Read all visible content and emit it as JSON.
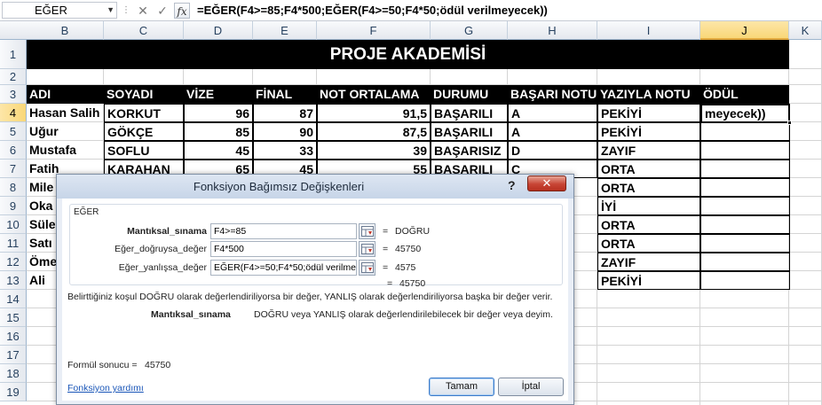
{
  "formula_bar": {
    "name_box": "EĞER",
    "name_dropdown": "▼",
    "separator": "⋮",
    "cancel_glyph": "✕",
    "enter_glyph": "✓",
    "fx_label": "fx",
    "formula": "=EĞER(F4>=85;F4*500;EĞER(F4>=50;F4*50;ödül verilmeyecek))"
  },
  "columns": [
    "B",
    "C",
    "D",
    "E",
    "F",
    "G",
    "H",
    "I",
    "J",
    "K"
  ],
  "rows": [
    "1",
    "2",
    "3",
    "4",
    "5",
    "6",
    "7",
    "8",
    "9",
    "10",
    "11",
    "12",
    "13",
    "14",
    "15",
    "16",
    "17",
    "18",
    "19"
  ],
  "sheet": {
    "title": "PROJE AKADEMİSİ",
    "headers": [
      "ADI",
      "SOYADI",
      "VİZE",
      "FİNAL",
      "NOT ORTALAMA",
      "DURUMU",
      "BAŞARI NOTU",
      "YAZIYLA NOTU",
      "ÖDÜL"
    ],
    "rows": [
      {
        "adi": "Hasan Salih",
        "soyadi": "KORKUT",
        "vize": "96",
        "final": "87",
        "ort": "91,5",
        "durum": "BAŞARILI",
        "notu": "A",
        "yazi": "PEKİYİ"
      },
      {
        "adi": "Uğur",
        "soyadi": "GÖKÇE",
        "vize": "85",
        "final": "90",
        "ort": "87,5",
        "durum": "BAŞARILI",
        "notu": "A",
        "yazi": "PEKİYİ"
      },
      {
        "adi": "Mustafa",
        "soyadi": "SOFLU",
        "vize": "45",
        "final": "33",
        "ort": "39",
        "durum": "BAŞARISIZ",
        "notu": "D",
        "yazi": "ZAYIF"
      },
      {
        "adi": "Fatih",
        "soyadi": "KARAHAN",
        "vize": "65",
        "final": "45",
        "ort": "55",
        "durum": "BAŞARILI",
        "notu": "C",
        "yazi": "ORTA"
      },
      {
        "adi": "Mile",
        "yazi": "ORTA"
      },
      {
        "adi": "Oka",
        "yazi": "İYİ"
      },
      {
        "adi": "Süle",
        "yazi": "ORTA"
      },
      {
        "adi": "Satı",
        "yazi": "ORTA"
      },
      {
        "adi": "Öme",
        "yazi": "ZAYIF"
      },
      {
        "adi": "Ali",
        "yazi": "PEKİYİ"
      }
    ],
    "active_cell_text": "meyecek))"
  },
  "dialog": {
    "title": "Fonksiyon Bağımsız Değişkenleri",
    "help_glyph": "?",
    "close_glyph": "✕",
    "function_name": "EĞER",
    "args": [
      {
        "label": "Mantıksal_sınama",
        "value": "F4>=85",
        "result": "DOĞRU"
      },
      {
        "label": "Eğer_doğruysa_değer",
        "value": "F4*500",
        "result": "45750"
      },
      {
        "label": "Eğer_yanlışsa_değer",
        "value": "EĞER(F4>=50;F4*50;ödül verilme",
        "result": "4575"
      }
    ],
    "equals": "=",
    "overall_result": "45750",
    "description": "Belirttiğiniz koşul DOĞRU olarak değerlendiriliyorsa bir değer, YANLIŞ olarak değerlendiriliyorsa başka bir değer verir.",
    "arg_help_name": "Mantıksal_sınama",
    "arg_help_text": "DOĞRU veya YANLIŞ olarak değerlendirilebilecek bir değer veya deyim.",
    "formula_result_label": "Formül sonucu =",
    "formula_result_value": "45750",
    "help_link": "Fonksiyon yardımı",
    "ok_label": "Tamam",
    "cancel_label": "İptal"
  }
}
